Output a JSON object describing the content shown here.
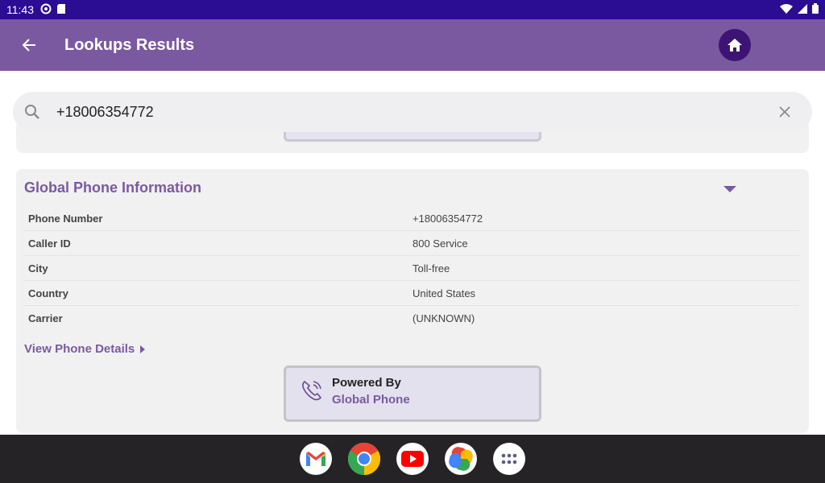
{
  "status_bar": {
    "time": "11:43"
  },
  "app_bar": {
    "title": "Lookups Results"
  },
  "search": {
    "value": "+18006354772"
  },
  "card": {
    "title": "Global Phone Information",
    "rows": [
      {
        "label": "Phone Number",
        "value": "+18006354772"
      },
      {
        "label": "Caller ID",
        "value": "800 Service"
      },
      {
        "label": "City",
        "value": "Toll-free"
      },
      {
        "label": "Country",
        "value": "United States"
      },
      {
        "label": "Carrier",
        "value": "(UNKNOWN)"
      }
    ],
    "details_link": "View Phone Details",
    "powered_by": {
      "label": "Powered By",
      "name": "Global Phone"
    }
  },
  "taskbar": {
    "apps": [
      "gmail-icon",
      "chrome-icon",
      "youtube-icon",
      "photos-icon",
      "app-drawer-icon"
    ]
  },
  "colors": {
    "accent": "#7b59a1",
    "status_bar": "#2a0d92",
    "home_button": "#3d1473",
    "taskbar": "#262327"
  }
}
